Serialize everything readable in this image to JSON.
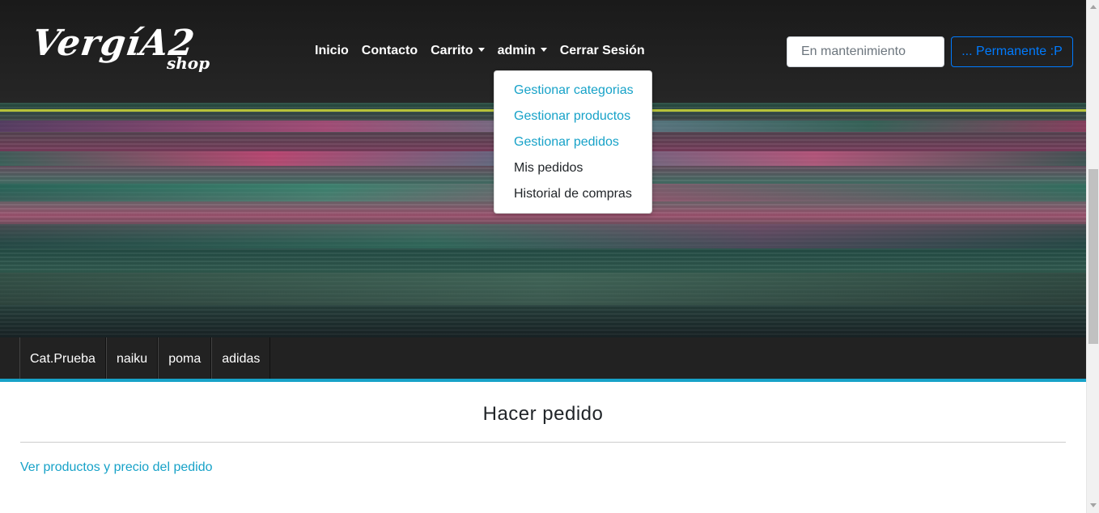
{
  "brand": {
    "name": "VergíA2",
    "tagline": "shop"
  },
  "nav": {
    "links": [
      {
        "label": "Inicio"
      },
      {
        "label": "Contacto"
      },
      {
        "label": "Carrito"
      },
      {
        "label": "admin"
      },
      {
        "label": "Cerrar Sesión"
      }
    ]
  },
  "admin_menu": {
    "items": [
      {
        "label": "Gestionar categorias"
      },
      {
        "label": "Gestionar productos"
      },
      {
        "label": "Gestionar pedidos"
      },
      {
        "label": "Mis pedidos"
      },
      {
        "label": "Historial de compras"
      }
    ]
  },
  "search": {
    "placeholder": "En mantenimiento",
    "value": ""
  },
  "perm_button": {
    "label": "... Permanente :P"
  },
  "categories": [
    {
      "label": "Cat.Prueba"
    },
    {
      "label": "naiku"
    },
    {
      "label": "poma"
    },
    {
      "label": "adidas"
    }
  ],
  "main": {
    "title": "Hacer pedido",
    "link": "Ver productos y precio del pedido"
  },
  "colors": {
    "accent": "#17a2c8",
    "primary": "#007bff",
    "navbar": "#222222"
  }
}
